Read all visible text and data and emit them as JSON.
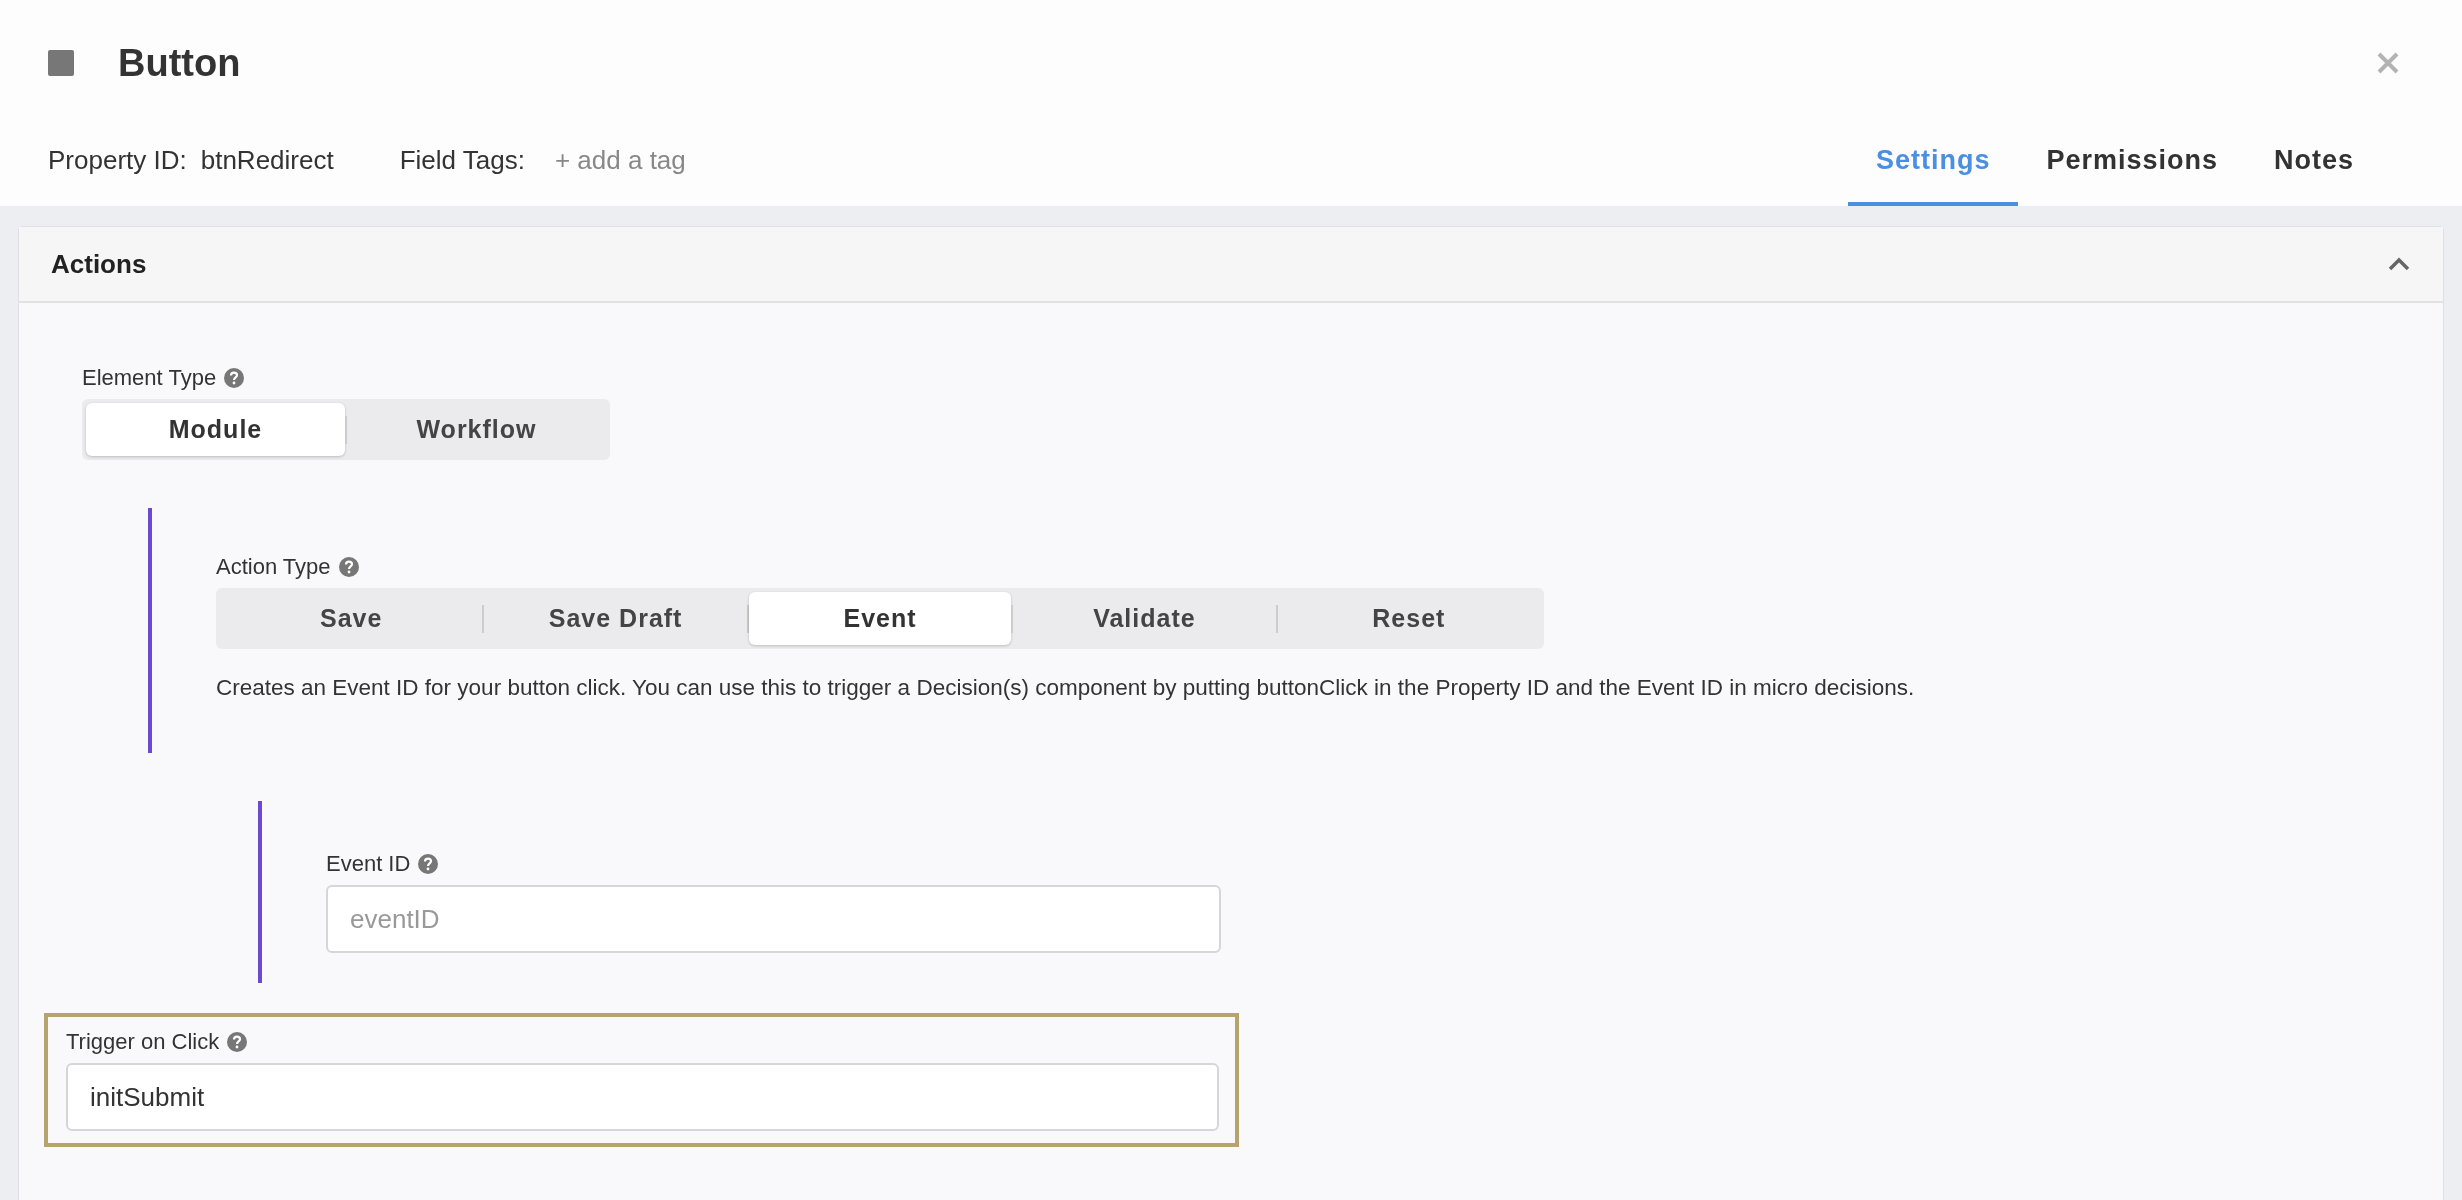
{
  "header": {
    "title": "Button",
    "property_id_label": "Property ID:",
    "property_id": "btnRedirect",
    "field_tags_label": "Field Tags:",
    "add_tag": "+ add a tag"
  },
  "tabs": [
    {
      "label": "Settings",
      "selected": true
    },
    {
      "label": "Permissions",
      "selected": false
    },
    {
      "label": "Notes",
      "selected": false
    }
  ],
  "section": {
    "title": "Actions",
    "expanded": true,
    "element_type": {
      "label": "Element Type",
      "options": [
        {
          "label": "Module",
          "selected": true
        },
        {
          "label": "Workflow",
          "selected": false
        }
      ]
    },
    "action_type": {
      "label": "Action Type",
      "options": [
        {
          "label": "Save",
          "selected": false
        },
        {
          "label": "Save Draft",
          "selected": false
        },
        {
          "label": "Event",
          "selected": true
        },
        {
          "label": "Validate",
          "selected": false
        },
        {
          "label": "Reset",
          "selected": false
        }
      ],
      "description": "Creates an Event ID for your button click. You can use this to trigger a Decision(s) component by putting buttonClick in the Property ID and the Event ID in micro decisions."
    },
    "event_id": {
      "label": "Event ID",
      "placeholder": "eventID"
    },
    "trigger_on_click": {
      "label": "Trigger on Click",
      "value": "initSubmit",
      "highlighted": true
    }
  }
}
